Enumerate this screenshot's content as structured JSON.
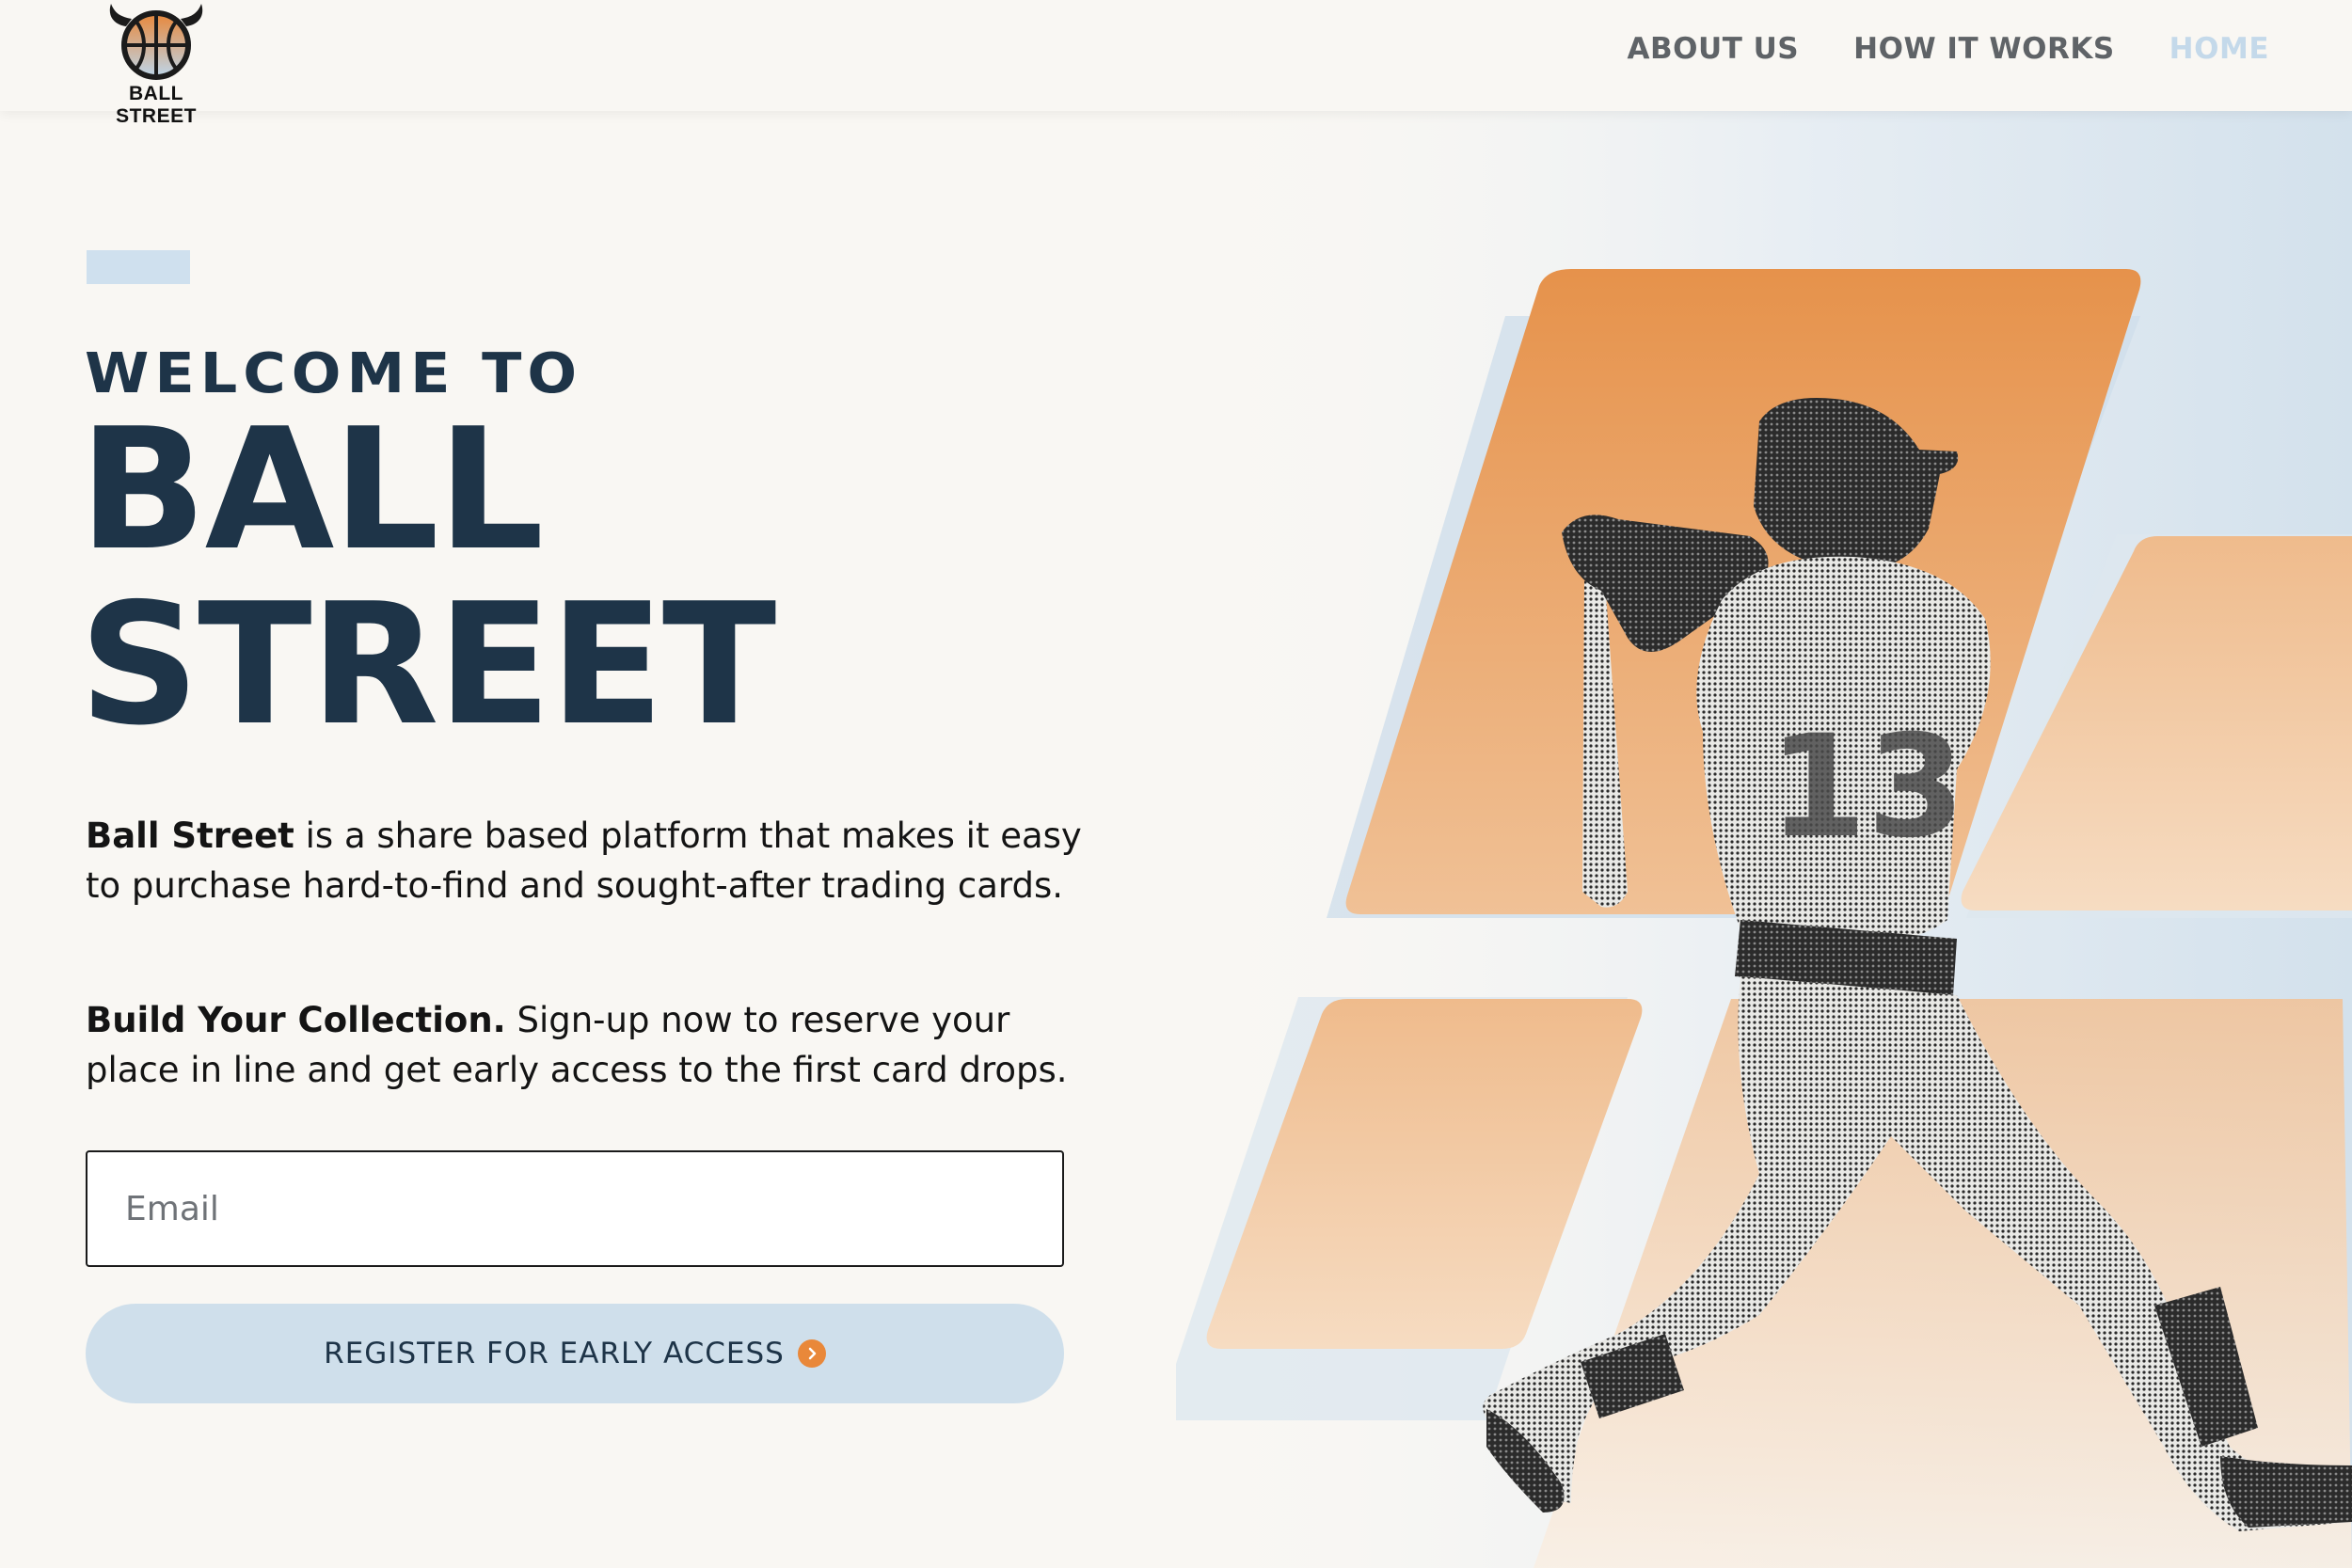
{
  "header": {
    "brand": "BALL STREET",
    "nav": [
      {
        "label": "ABOUT US",
        "active": false
      },
      {
        "label": "HOW IT WORKS",
        "active": false
      },
      {
        "label": "HOME",
        "active": true
      }
    ]
  },
  "hero": {
    "eyebrow": "WELCOME TO",
    "title_line1": "BALL",
    "title_line2": "STREET",
    "desc1_bold": "Ball Street",
    "desc1_text": " is a share based platform that makes it easy to purchase hard-to-find and sought-after trading cards.",
    "desc2_bold": "Build Your Collection.",
    "desc2_text": " Sign-up now to reserve your place in line and get early access to the first card drops.",
    "email_placeholder": "Email",
    "email_value": "",
    "cta_label": "REGISTER FOR EARLY ACCESS",
    "cta_icon": "chevron-right-circle-icon",
    "player_jersey_number": "13"
  },
  "colors": {
    "background": "#f9f7f3",
    "navy": "#1e3448",
    "light_blue": "#cfdfeb",
    "orange": "#e9883a",
    "nav_gray": "#5f6367",
    "nav_active": "#c4d9ea"
  },
  "icons": {
    "logo": "bull-basketball-logo-icon",
    "cta": "chevron-right-circle-icon",
    "hero_image": "baseball-player-swing-illustration"
  }
}
